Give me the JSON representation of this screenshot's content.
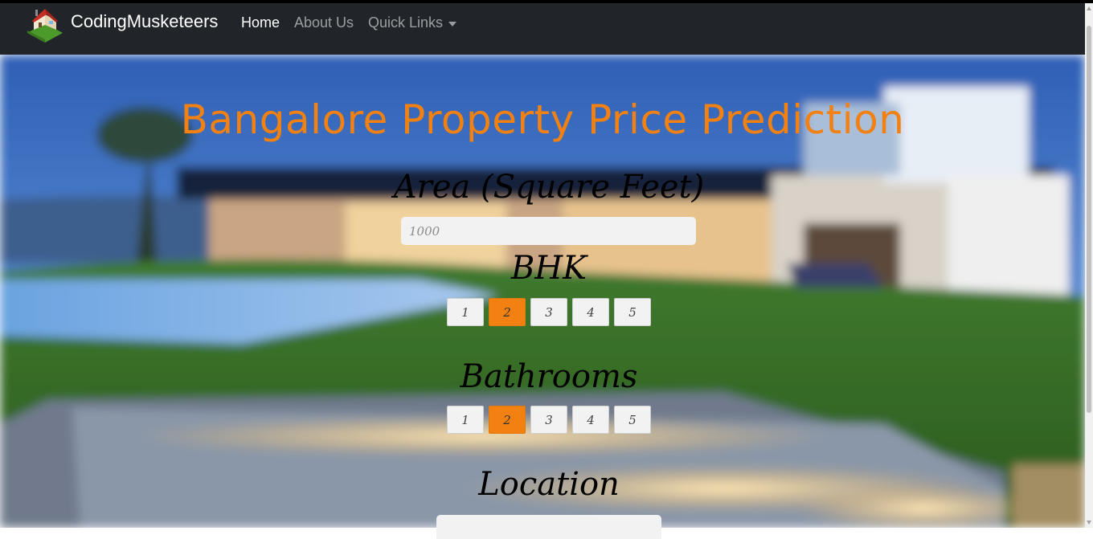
{
  "navbar": {
    "brand": "CodingMusketeers",
    "links": [
      {
        "label": "Home"
      },
      {
        "label": "About Us"
      },
      {
        "label": "Quick Links"
      }
    ]
  },
  "main": {
    "title": "Bangalore Property Price Prediction",
    "area": {
      "label": "Area (Square Feet)",
      "placeholder": "1000"
    },
    "bhk": {
      "label": "BHK",
      "options": [
        "1",
        "2",
        "3",
        "4",
        "5"
      ],
      "selected": "2"
    },
    "bathrooms": {
      "label": "Bathrooms",
      "options": [
        "1",
        "2",
        "3",
        "4",
        "5"
      ],
      "selected": "2"
    },
    "location": {
      "label": "Location"
    }
  },
  "colors": {
    "accent": "#f28112",
    "navbar_bg": "#212529"
  }
}
